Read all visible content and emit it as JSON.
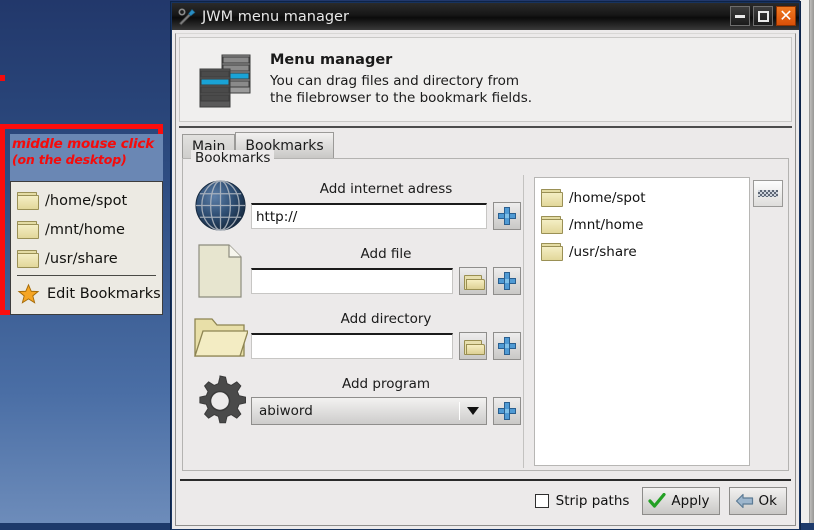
{
  "desktop": {
    "annotation": {
      "line1": "middle mouse click",
      "line2": "(on the desktop)",
      "color": "#f50b0b",
      "box_color": "#fb0d0d"
    },
    "popup_menu": {
      "items": [
        {
          "icon": "folder-icon",
          "label": "/home/spot"
        },
        {
          "icon": "folder-icon",
          "label": "/mnt/home"
        },
        {
          "icon": "folder-icon",
          "label": "/usr/share"
        }
      ],
      "edit_item": {
        "icon": "star-icon",
        "label": "Edit Bookmarks"
      }
    }
  },
  "window": {
    "title": "JWM menu manager",
    "title_icon": "tools-icon",
    "buttons": {
      "minimize": "minimize-icon",
      "maximize": "maximize-icon",
      "close": "close-icon",
      "close_color": "#e05a0c"
    },
    "banner": {
      "icon": "menu-stack-icon",
      "title": "Menu manager",
      "line1": "You can drag files and directory from",
      "line2": "the filebrowser to the bookmark fields."
    },
    "tabs": [
      {
        "label": "Main",
        "active": false
      },
      {
        "label": "Bookmarks",
        "active": true
      }
    ],
    "group": {
      "legend": "Bookmarks",
      "rows": [
        {
          "icon": "globe-icon",
          "label": "Add internet adress",
          "value": "http://",
          "placeholder": "",
          "has_browse": false,
          "add_label": "+"
        },
        {
          "icon": "file-icon",
          "label": "Add file",
          "value": "",
          "placeholder": "",
          "has_browse": true,
          "add_label": "+"
        },
        {
          "icon": "folder-icon",
          "label": "Add directory",
          "value": "",
          "placeholder": "",
          "has_browse": true,
          "add_label": "+"
        },
        {
          "icon": "gear-icon",
          "label": "Add program",
          "value": "abiword",
          "placeholder": "",
          "has_browse": false,
          "add_label": "+"
        }
      ],
      "list": [
        {
          "icon": "folder-icon",
          "label": "/home/spot"
        },
        {
          "icon": "folder-icon",
          "label": "/mnt/home"
        },
        {
          "icon": "folder-icon",
          "label": "/usr/share"
        }
      ],
      "grip_button": "resize-grip-icon"
    },
    "bottom": {
      "strip_paths_label": "Strip paths",
      "strip_paths_checked": false,
      "apply_label": "Apply",
      "apply_icon": "check-icon",
      "ok_label": "Ok",
      "ok_icon": "back-arrow-icon"
    }
  }
}
